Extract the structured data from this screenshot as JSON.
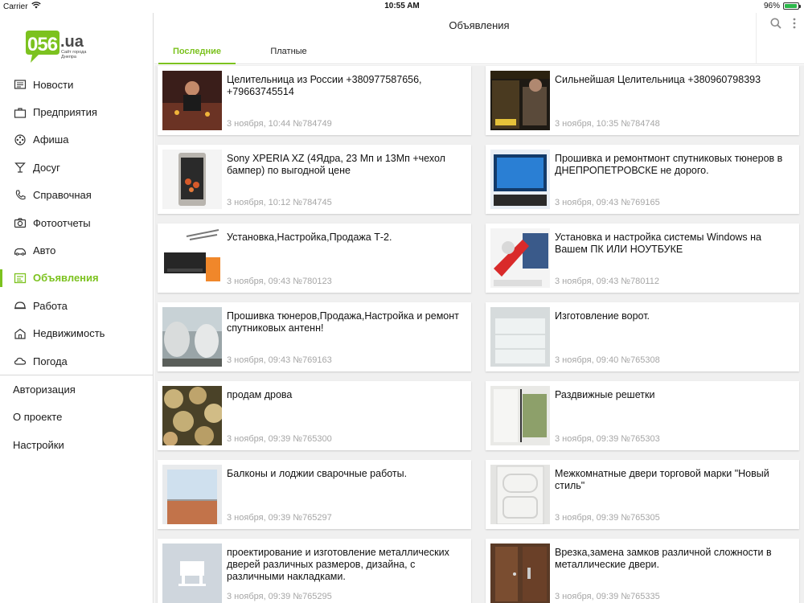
{
  "status": {
    "carrier": "Carrier",
    "time": "10:55 AM",
    "battery": "96%"
  },
  "logo": {
    "brand": "056.ua",
    "tagline_line1": "Сайт города",
    "tagline_line2": "Днепра"
  },
  "sidebar": {
    "items": [
      {
        "label": "Новости",
        "icon": "newspaper-icon"
      },
      {
        "label": "Предприятия",
        "icon": "briefcase-icon"
      },
      {
        "label": "Афиша",
        "icon": "film-reel-icon"
      },
      {
        "label": "Досуг",
        "icon": "cocktail-icon"
      },
      {
        "label": "Справочная",
        "icon": "phone-book-icon"
      },
      {
        "label": "Фотоотчеты",
        "icon": "camera-icon"
      },
      {
        "label": "Авто",
        "icon": "car-icon"
      },
      {
        "label": "Объявления",
        "icon": "ads-board-icon",
        "active": true
      },
      {
        "label": "Работа",
        "icon": "hard-hat-icon"
      },
      {
        "label": "Недвижимость",
        "icon": "building-icon"
      },
      {
        "label": "Погода",
        "icon": "weather-icon"
      }
    ],
    "extra": [
      "Авторизация",
      "О проекте",
      "Настройки"
    ]
  },
  "header": {
    "title": "Объявления",
    "tabs": [
      "Последние",
      "Платные"
    ]
  },
  "ads": [
    {
      "title": "Целительница из России +380977587656, +79663745514",
      "meta": "3 ноября, 10:44 №784749"
    },
    {
      "title": "Сильнейшая Целительница +380960798393",
      "meta": "3 ноября, 10:35 №784748"
    },
    {
      "title": "Sony XPERIA XZ (4Ядра, 23 Мп и 13Мп +чехол бампер) по выгодной цене",
      "meta": "3 ноября, 10:12 №784745"
    },
    {
      "title": "Прошивка и ремонтмонт спутниковых тюнеров в ДНЕПРОПЕТРОВСКЕ не дорого.",
      "meta": "3 ноября, 09:43 №769165"
    },
    {
      "title": "Установка,Настройка,Продажа Т-2.",
      "meta": "3 ноября, 09:43 №780123"
    },
    {
      "title": "Установка и настройка системы Windows на Вашем ПК ИЛИ НОУТБУКЕ",
      "meta": "3 ноября, 09:43 №780112"
    },
    {
      "title": "Прошивка тюнеров,Продажа,Настройка и ремонт спутниковых антенн!",
      "meta": "3 ноября, 09:43 №769163"
    },
    {
      "title": "Изготовление ворот.",
      "meta": "3 ноября, 09:40 №765308"
    },
    {
      "title": "продам дрова",
      "meta": "3 ноября, 09:39 №765300"
    },
    {
      "title": "Раздвижные решетки",
      "meta": "3 ноября, 09:39 №765303"
    },
    {
      "title": "Балконы и лоджии сварочные работы.",
      "meta": "3 ноября, 09:39 №765297"
    },
    {
      "title": "Межкомнатные двери торговой марки \"Новый стиль\"",
      "meta": "3 ноября, 09:39 №765305"
    },
    {
      "title": "проектирование и изготовление металлических дверей различных размеров, дизайна, с различными накладками.",
      "meta": "3 ноября, 09:39 №765295"
    },
    {
      "title": "Врезка,замена замков различной сложности в металлические двери.",
      "meta": "3 ноября, 09:39 №765335"
    }
  ],
  "colors": {
    "accent": "#7cc21f",
    "meta_text": "#a6a6a6",
    "list_bg": "#f0f0f0"
  }
}
